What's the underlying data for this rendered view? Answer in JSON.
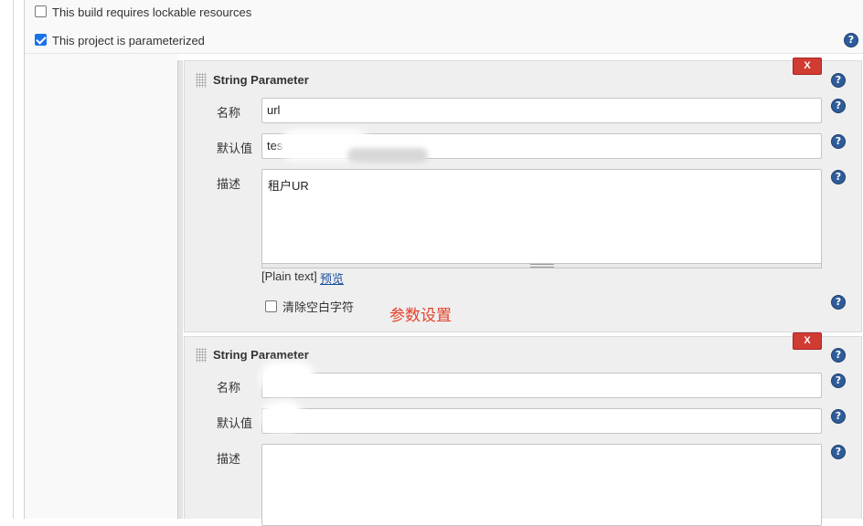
{
  "options": {
    "lockable": {
      "label": "This build requires lockable resources",
      "checked": false
    },
    "parameterized": {
      "label": "This project is parameterized",
      "checked": true
    }
  },
  "params": [
    {
      "type_title": "String Parameter",
      "delete_label": "X",
      "name_label": "名称",
      "name_value": "url",
      "default_label": "默认值",
      "default_value": "tes",
      "desc_label": "描述",
      "desc_value": "租户UR",
      "plain_text": "[Plain text]",
      "preview_link": "预览",
      "trim_label": "清除空白字符",
      "trim_checked": false
    },
    {
      "type_title": "String Parameter",
      "delete_label": "X",
      "name_label": "名称",
      "name_value": "",
      "default_label": "默认值",
      "default_value": "",
      "desc_label": "描述",
      "desc_value": ""
    }
  ],
  "annotation": "参数设置",
  "help_glyph": "?",
  "icons": [
    "help-icon",
    "drag-handle-icon",
    "checkbox-icon"
  ],
  "colors": {
    "delete_red": "#d03b32",
    "help_blue": "#2e5c9a",
    "link_blue": "#1b4f9c",
    "annotation_red": "#e2412a"
  }
}
